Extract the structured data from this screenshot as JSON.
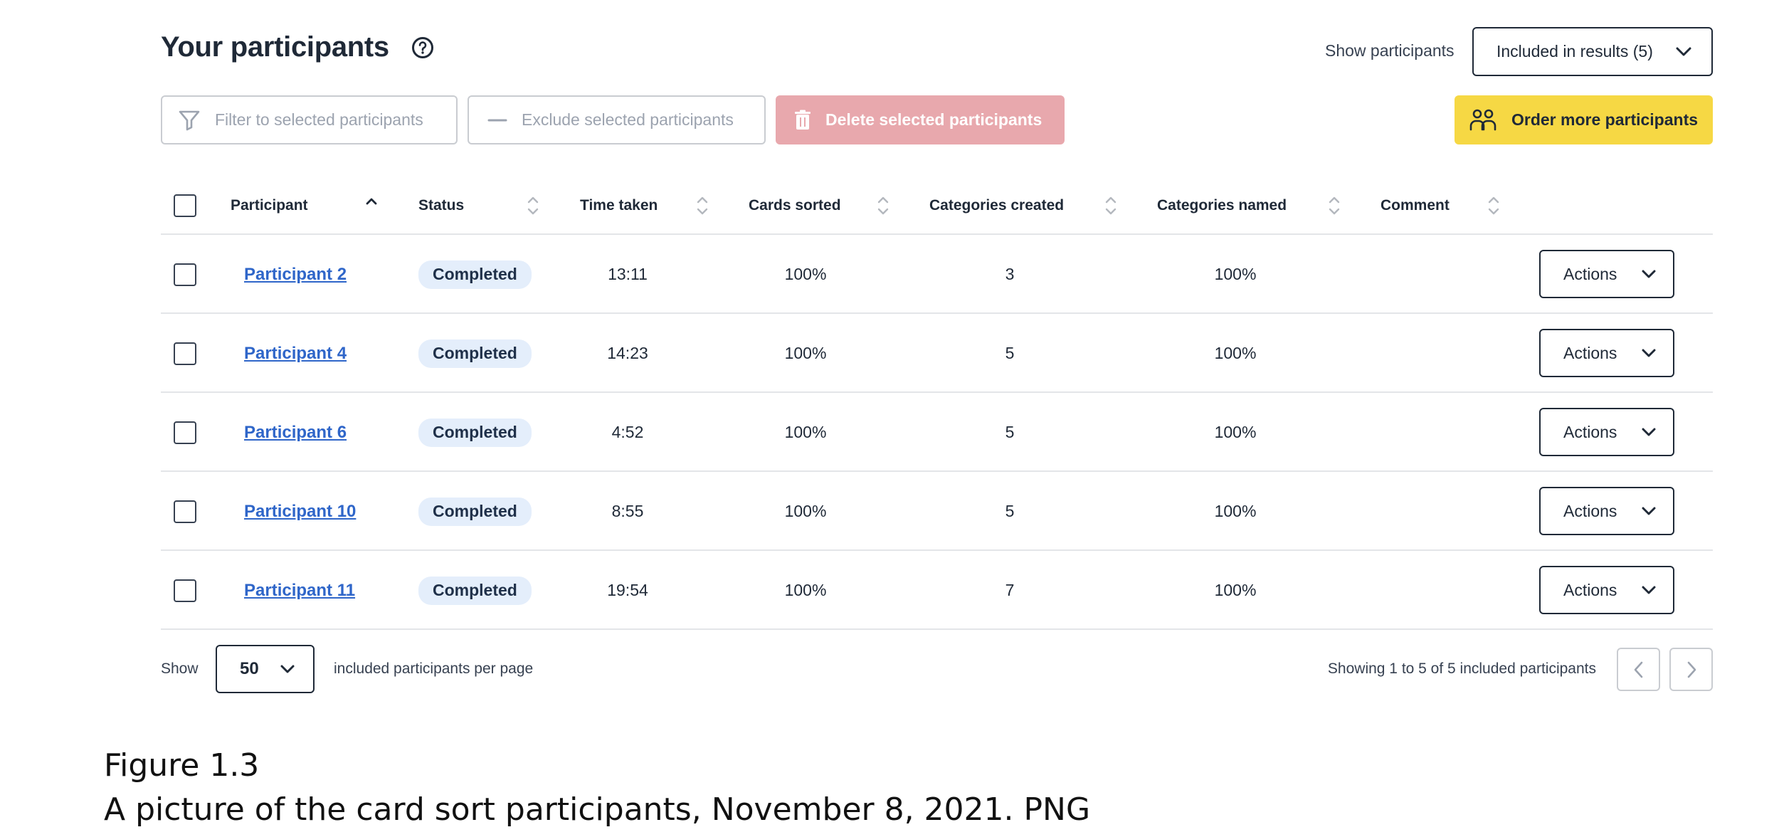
{
  "header": {
    "title": "Your participants",
    "show_label": "Show participants",
    "show_select_value": "Included in results (5)"
  },
  "toolbar": {
    "filter_label": "Filter to selected participants",
    "exclude_label": "Exclude selected participants",
    "delete_label": "Delete selected participants",
    "order_label": "Order more participants"
  },
  "table": {
    "columns": [
      "Participant",
      "Status",
      "Time taken",
      "Cards sorted",
      "Categories created",
      "Categories named",
      "Comment"
    ],
    "rows": [
      {
        "participant": "Participant 2",
        "status": "Completed",
        "time": "13:11",
        "cards_sorted": "100%",
        "categories_created": "3",
        "categories_named": "100%",
        "comment": "",
        "action": "Actions"
      },
      {
        "participant": "Participant 4",
        "status": "Completed",
        "time": "14:23",
        "cards_sorted": "100%",
        "categories_created": "5",
        "categories_named": "100%",
        "comment": "",
        "action": "Actions"
      },
      {
        "participant": "Participant 6",
        "status": "Completed",
        "time": "4:52",
        "cards_sorted": "100%",
        "categories_created": "5",
        "categories_named": "100%",
        "comment": "",
        "action": "Actions"
      },
      {
        "participant": "Participant 10",
        "status": "Completed",
        "time": "8:55",
        "cards_sorted": "100%",
        "categories_created": "5",
        "categories_named": "100%",
        "comment": "",
        "action": "Actions"
      },
      {
        "participant": "Participant 11",
        "status": "Completed",
        "time": "19:54",
        "cards_sorted": "100%",
        "categories_created": "7",
        "categories_named": "100%",
        "comment": "",
        "action": "Actions"
      }
    ]
  },
  "footer": {
    "show_label": "Show",
    "per_page_value": "50",
    "per_page_suffix": "included participants per page",
    "showing_text": "Showing 1 to 5 of 5 included participants"
  },
  "caption": {
    "line1": "Figure 1.3",
    "line2": "A picture of the card sort participants, November 8, 2021. PNG"
  },
  "colors": {
    "accent_yellow": "#f6d844",
    "delete_disabled": "#e8a8ad",
    "link_blue": "#2f66c9",
    "badge_bg": "#e4eefb"
  },
  "icons": [
    "help-icon",
    "chevron-down-icon",
    "filter-icon",
    "minus-icon",
    "trash-icon",
    "people-icon",
    "sort-icon",
    "chevron-left-icon",
    "chevron-right-icon"
  ]
}
